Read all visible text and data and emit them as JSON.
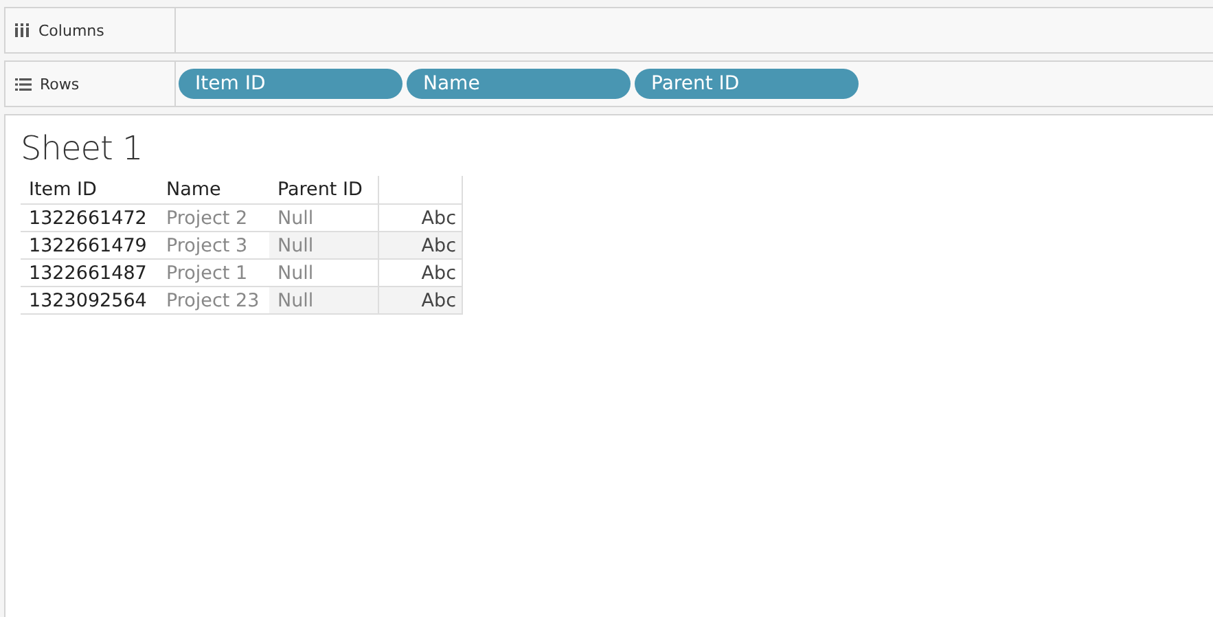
{
  "shelves": [
    {
      "kind": "columns",
      "label": "Columns"
    },
    {
      "kind": "rows",
      "label": "Rows",
      "pills": [
        "Item ID",
        "Name",
        "Parent ID"
      ]
    }
  ],
  "sheet": {
    "title": "Sheet 1",
    "table": {
      "columns": [
        "Item ID",
        "Name",
        "Parent ID"
      ],
      "rows": [
        {
          "item_id": "1322661472",
          "name": "Project 2",
          "parent_id": "Null",
          "mark": "Abc"
        },
        {
          "item_id": "1322661479",
          "name": "Project 3",
          "parent_id": "Null",
          "mark": "Abc"
        },
        {
          "item_id": "1322661487",
          "name": "Project 1",
          "parent_id": "Null",
          "mark": "Abc"
        },
        {
          "item_id": "1323092564",
          "name": "Project 23",
          "parent_id": "Null",
          "mark": "Abc"
        }
      ]
    }
  }
}
